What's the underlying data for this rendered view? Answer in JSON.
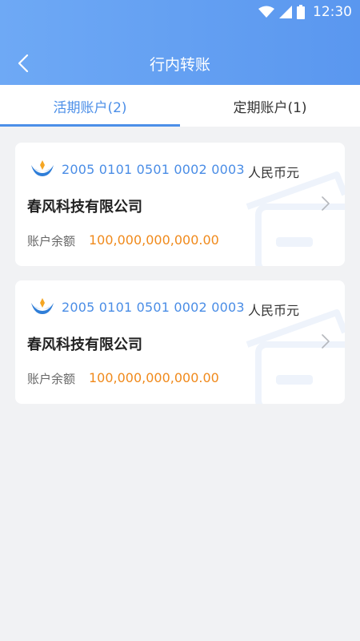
{
  "status_bar": {
    "time": "12:30"
  },
  "nav": {
    "title": "行内转账",
    "back_icon": "chevron-left-icon"
  },
  "tabs": [
    {
      "label": "活期账户(2)",
      "active": true
    },
    {
      "label": "定期账户(1)",
      "active": false
    }
  ],
  "accounts": [
    {
      "account_number": "2005 0101 0501 0002 0003",
      "currency": "人民币元",
      "company": "春风科技有限公司",
      "balance_label": "账户余额",
      "balance": "100,000,000,000.00"
    },
    {
      "account_number": "2005 0101 0501 0002 0003",
      "currency": "人民币元",
      "company": "春风科技有限公司",
      "balance_label": "账户余额",
      "balance": "100,000,000,000.00"
    }
  ],
  "colors": {
    "header": "#5f9cf0",
    "accent": "#4c8fe8",
    "balance": "#f08a1c",
    "background": "#f1f2f4"
  }
}
